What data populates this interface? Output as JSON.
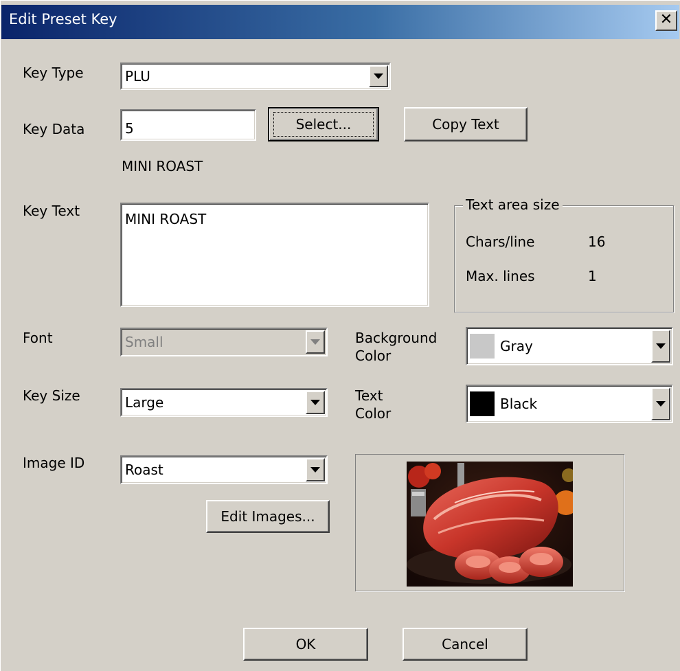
{
  "window": {
    "title": "Edit Preset Key",
    "close_glyph": "✕"
  },
  "key_type": {
    "label": "Key Type",
    "value": "PLU"
  },
  "key_data": {
    "label": "Key Data",
    "value": "5",
    "select_button": "Select...",
    "copy_text_button": "Copy Text",
    "description": "MINI ROAST"
  },
  "key_text": {
    "label": "Key Text",
    "value": "MINI ROAST"
  },
  "text_area_size": {
    "legend": "Text area size",
    "chars_per_line_label": "Chars/line",
    "chars_per_line_value": "16",
    "max_lines_label": "Max. lines",
    "max_lines_value": "1"
  },
  "font": {
    "label": "Font",
    "value": "Small",
    "disabled": true
  },
  "background_color": {
    "label_line1": "Background",
    "label_line2": "Color",
    "value": "Gray",
    "swatch": "#c8c8c8"
  },
  "key_size": {
    "label": "Key Size",
    "value": "Large"
  },
  "text_color": {
    "label_line1": "Text",
    "label_line2": "Color",
    "value": "Black",
    "swatch": "#000000"
  },
  "image_id": {
    "label": "Image ID",
    "value": "Roast",
    "edit_images_button": "Edit Images...",
    "preview": "roast-meat-photo"
  },
  "footer": {
    "ok_button": "OK",
    "cancel_button": "Cancel"
  },
  "icons": {
    "dropdown": "chevron-down-icon",
    "close": "close-icon"
  }
}
